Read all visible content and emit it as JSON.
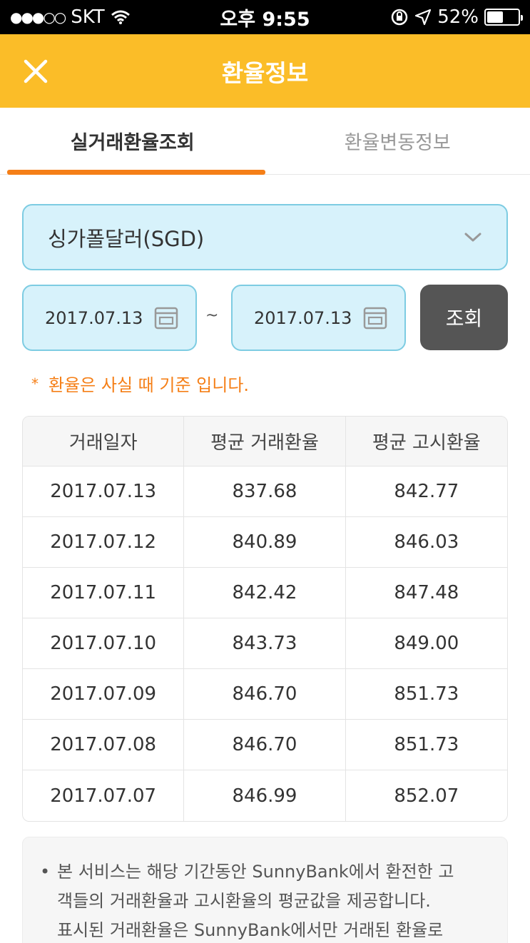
{
  "status_bar": {
    "signal": "●●●○○",
    "carrier": "SKT",
    "time": "오후 9:55",
    "battery": "52%",
    "battery_level": 0.52
  },
  "header": {
    "title": "환율정보"
  },
  "tabs": [
    {
      "label": "실거래환율조회",
      "active": true
    },
    {
      "label": "환율변동정보",
      "active": false
    }
  ],
  "currency": {
    "selected": "싱가폴달러(SGD)"
  },
  "date_range": {
    "start": "2017.07.13",
    "separator": "~",
    "end": "2017.07.13"
  },
  "search_button": {
    "label": "조회"
  },
  "note": {
    "marker": "*",
    "text": "환율은 사실 때 기준 입니다."
  },
  "table": {
    "headers": [
      "거래일자",
      "평균 거래환율",
      "평균 고시환율"
    ],
    "rows": [
      [
        "2017.07.13",
        "837.68",
        "842.77"
      ],
      [
        "2017.07.12",
        "840.89",
        "846.03"
      ],
      [
        "2017.07.11",
        "842.42",
        "847.48"
      ],
      [
        "2017.07.10",
        "843.73",
        "849.00"
      ],
      [
        "2017.07.09",
        "846.70",
        "851.73"
      ],
      [
        "2017.07.08",
        "846.70",
        "851.73"
      ],
      [
        "2017.07.07",
        "846.99",
        "852.07"
      ]
    ]
  },
  "info": {
    "bullet": "•",
    "lines": [
      "본 서비스는 해당 기간동안 SunnyBank에서 환전한 고",
      "객들의 거래환율과 고시환율의 평균값을 제공합니다.",
      "표시된 거래환율은 SunnyBank에서만 거래된 환율로"
    ]
  },
  "colors": {
    "header_bg": "#fbbd28",
    "tab_accent": "#f57f17",
    "input_bg": "#d7f2fb",
    "input_border": "#7dcce2",
    "button_bg": "#555555",
    "note_color": "#f57f17"
  }
}
